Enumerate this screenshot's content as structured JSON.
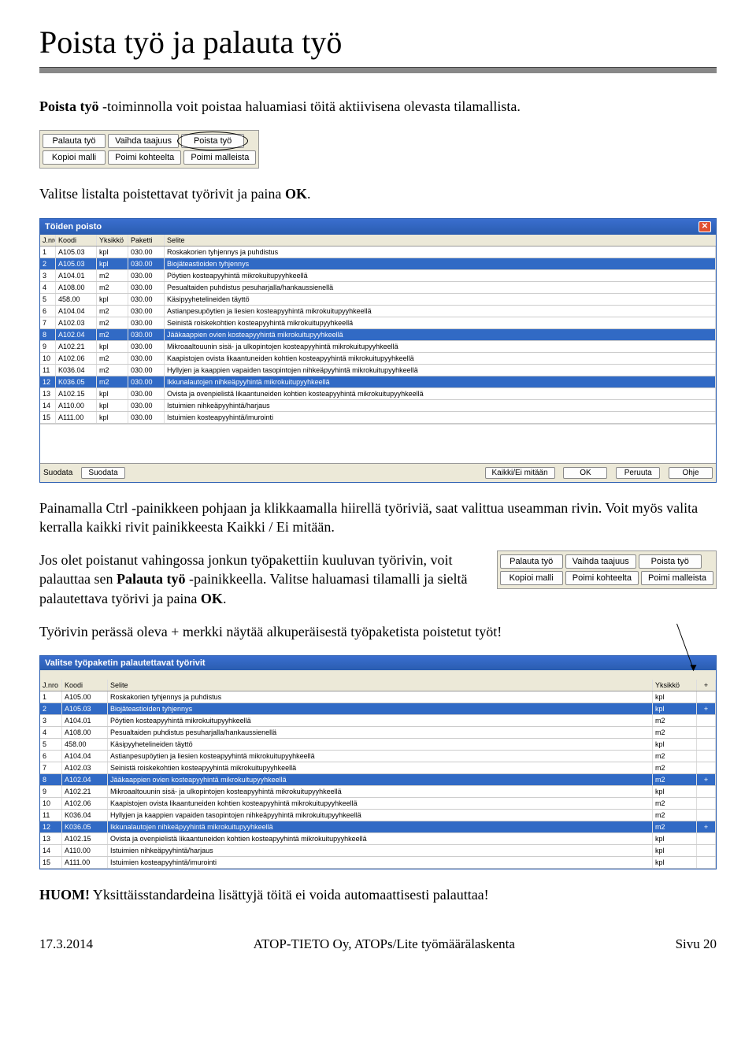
{
  "title": "Poista työ ja palauta työ",
  "para1_a": "Poista työ ",
  "para1_b": "-toiminnolla voit poistaa haluamiasi töitä aktiivisena olevasta tilamallista.",
  "toolbar1": {
    "r1": [
      "Palauta työ",
      "Vaihda taajuus",
      "Poista työ"
    ],
    "r2": [
      "Kopioi malli",
      "Poimi kohteelta",
      "Poimi malleista"
    ]
  },
  "para2_a": "Valitse listalta poistettavat työrivit ja paina ",
  "para2_b": "OK",
  "para2_c": ".",
  "dialog1": {
    "title": "Töiden poisto",
    "cols": [
      "J.nro",
      "Koodi",
      "Yksikkö",
      "Paketti",
      "Selite"
    ],
    "rows": [
      {
        "n": "1",
        "k": "A105.03",
        "y": "kpl",
        "p": "030.00",
        "s": "Roskakorien tyhjennys ja puhdistus",
        "sel": false
      },
      {
        "n": "2",
        "k": "A105.03",
        "y": "kpl",
        "p": "030.00",
        "s": "Biojäteastioiden tyhjennys",
        "sel": true
      },
      {
        "n": "3",
        "k": "A104.01",
        "y": "m2",
        "p": "030.00",
        "s": "Pöytien kosteapyyhintä mikrokuitupyyhkeellä",
        "sel": false
      },
      {
        "n": "4",
        "k": "A108.00",
        "y": "m2",
        "p": "030.00",
        "s": "Pesualtaiden puhdistus pesuharjalla/hankaussienellä",
        "sel": false
      },
      {
        "n": "5",
        "k": "458.00",
        "y": "kpl",
        "p": "030.00",
        "s": "Käsipyyhetelineiden täyttö",
        "sel": false
      },
      {
        "n": "6",
        "k": "A104.04",
        "y": "m2",
        "p": "030.00",
        "s": "Astianpesupöytien ja liesien kosteapyyhintä mikrokuitupyyhkeellä",
        "sel": false
      },
      {
        "n": "7",
        "k": "A102.03",
        "y": "m2",
        "p": "030.00",
        "s": "Seinistä roiskekohtien kosteapyyhintä mikrokuitupyyhkeellä",
        "sel": false
      },
      {
        "n": "8",
        "k": "A102.04",
        "y": "m2",
        "p": "030.00",
        "s": "Jääkaappien ovien kosteapyyhintä mikrokuitupyyhkeellä",
        "sel": true
      },
      {
        "n": "9",
        "k": "A102.21",
        "y": "kpl",
        "p": "030.00",
        "s": "Mikroaaltouunin sisä- ja ulkopintojen kosteapyyhintä mikrokuitupyyhkeellä",
        "sel": false
      },
      {
        "n": "10",
        "k": "A102.06",
        "y": "m2",
        "p": "030.00",
        "s": "Kaapistojen ovista likaantuneiden kohtien kosteapyyhintä mikrokuitupyyhkeellä",
        "sel": false
      },
      {
        "n": "11",
        "k": "K036.04",
        "y": "m2",
        "p": "030.00",
        "s": "Hyllyjen ja kaappien vapaiden tasopintojen nihkeäpyyhintä mikrokuitupyyhkeellä",
        "sel": false
      },
      {
        "n": "12",
        "k": "K036.05",
        "y": "m2",
        "p": "030.00",
        "s": "Ikkunalautojen nihkeäpyyhintä mikrokuitupyyhkeellä",
        "sel": true
      },
      {
        "n": "13",
        "k": "A102.15",
        "y": "kpl",
        "p": "030.00",
        "s": "Ovista ja ovenpielistä likaantuneiden kohtien kosteapyyhintä mikrokuitupyyhkeellä",
        "sel": false
      },
      {
        "n": "14",
        "k": "A110.00",
        "y": "kpl",
        "p": "030.00",
        "s": "Istuimien nihkeäpyyhintä/harjaus",
        "sel": false
      },
      {
        "n": "15",
        "k": "A111.00",
        "y": "kpl",
        "p": "030.00",
        "s": "Istuimien kosteapyyhintä/imurointi",
        "sel": false
      }
    ],
    "suodata": "Suodata",
    "footer_btns": [
      "Kaikki/Ei mitään",
      "OK",
      "Peruuta",
      "Ohje"
    ]
  },
  "para3": "Painamalla Ctrl -painikkeen pohjaan ja klikkaamalla hiirellä työriviä, saat valittua useamman rivin. Voit myös valita kerralla kaikki rivit painikkeesta Kaikki / Ei mitään.",
  "para4_a": "Jos olet poistanut vahingossa jonkun työpakettiin kuuluvan työrivin, voit palauttaa sen ",
  "para4_b": "Palauta työ",
  "para4_c": " -painikkeella. Valitse haluamasi tilamalli ja sieltä palautettava työrivi ja paina ",
  "para4_d": "OK",
  "para4_e": ".",
  "toolbar2": {
    "r1": [
      "Palauta työ",
      "Vaihda taajuus",
      "Poista työ"
    ],
    "r2": [
      "Kopioi malli",
      "Poimi kohteelta",
      "Poimi malleista"
    ]
  },
  "para5": "Työrivin perässä oleva + merkki näytää alkuperäisestä työpaketista poistetut työt!",
  "dialog2": {
    "title": "Valitse työpaketin palautettavat työrivit",
    "cols": [
      "J.nro",
      "Koodi",
      "Selite",
      "Yksikkö",
      "+"
    ],
    "rows": [
      {
        "n": "1",
        "k": "A105.00",
        "s": "Roskakorien tyhjennys ja puhdistus",
        "y": "kpl",
        "p": "",
        "sel": false
      },
      {
        "n": "2",
        "k": "A105.03",
        "s": "Biojäteastioiden tyhjennys",
        "y": "kpl",
        "p": "+",
        "sel": true
      },
      {
        "n": "3",
        "k": "A104.01",
        "s": "Pöytien kosteapyyhintä mikrokuitupyyhkeellä",
        "y": "m2",
        "p": "",
        "sel": false
      },
      {
        "n": "4",
        "k": "A108.00",
        "s": "Pesualtaiden puhdistus pesuharjalla/hankaussienellä",
        "y": "m2",
        "p": "",
        "sel": false
      },
      {
        "n": "5",
        "k": "458.00",
        "s": "Käsipyyhetelineiden täyttö",
        "y": "kpl",
        "p": "",
        "sel": false
      },
      {
        "n": "6",
        "k": "A104.04",
        "s": "Astianpesupöytien ja liesien kosteapyyhintä mikrokuitupyyhkeellä",
        "y": "m2",
        "p": "",
        "sel": false
      },
      {
        "n": "7",
        "k": "A102.03",
        "s": "Seinistä roiskekohtien kosteapyyhintä mikrokuitupyyhkeellä",
        "y": "m2",
        "p": "",
        "sel": false
      },
      {
        "n": "8",
        "k": "A102.04",
        "s": "Jääkaappien ovien kosteapyyhintä mikrokuitupyyhkeellä",
        "y": "m2",
        "p": "+",
        "sel": true
      },
      {
        "n": "9",
        "k": "A102.21",
        "s": "Mikroaaltouunin sisä- ja ulkopintojen kosteapyyhintä mikrokuitupyyhkeellä",
        "y": "kpl",
        "p": "",
        "sel": false
      },
      {
        "n": "10",
        "k": "A102.06",
        "s": "Kaapistojen ovista likaantuneiden kohtien kosteapyyhintä mikrokuitupyyhkeellä",
        "y": "m2",
        "p": "",
        "sel": false
      },
      {
        "n": "11",
        "k": "K036.04",
        "s": "Hyllyjen ja kaappien vapaiden tasopintojen nihkeäpyyhintä mikrokuitupyyhkeellä",
        "y": "m2",
        "p": "",
        "sel": false
      },
      {
        "n": "12",
        "k": "K036.05",
        "s": "Ikkunalautojen nihkeäpyyhintä mikrokuitupyyhkeellä",
        "y": "m2",
        "p": "+",
        "sel": true
      },
      {
        "n": "13",
        "k": "A102.15",
        "s": "Ovista ja ovenpielistä likaantuneiden kohtien kosteapyyhintä mikrokuitupyyhkeellä",
        "y": "kpl",
        "p": "",
        "sel": false
      },
      {
        "n": "14",
        "k": "A110.00",
        "s": "Istuimien nihkeäpyyhintä/harjaus",
        "y": "kpl",
        "p": "",
        "sel": false
      },
      {
        "n": "15",
        "k": "A111.00",
        "s": "Istuimien kosteapyyhintä/imurointi",
        "y": "kpl",
        "p": "",
        "sel": false
      }
    ]
  },
  "huom_a": "HUOM!",
  "huom_b": " Yksittäisstandardeina lisättyjä töitä ei voida automaattisesti palauttaa!",
  "footer": {
    "date": "17.3.2014",
    "center": "ATOP-TIETO Oy, ATOPs/Lite työmäärälaskenta",
    "page": "Sivu 20"
  }
}
